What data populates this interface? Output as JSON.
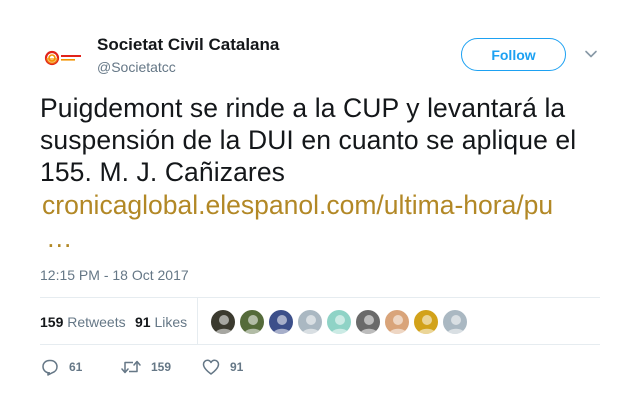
{
  "author": {
    "display_name": "Societat Civil Catalana",
    "handle": "@Societatcc"
  },
  "follow_label": "Follow",
  "tweet": {
    "text": "Puigdemont se rinde a la CUP y levantará la suspensión de la DUI en cuanto se aplique el 155. M. J. Cañizares",
    "link": "cronicaglobal.elespanol.com/ultima-hora/pu",
    "ellipsis": "…",
    "timestamp": "12:15 PM - 18 Oct 2017"
  },
  "stats": {
    "retweets_count": "159",
    "retweets_label": "Retweets",
    "likes_count": "91",
    "likes_label": "Likes"
  },
  "likers": [
    {
      "name": "liker-1",
      "color": "#3b3a2f"
    },
    {
      "name": "liker-2",
      "color": "#556b3a"
    },
    {
      "name": "liker-3",
      "color": "#3c4f8a"
    },
    {
      "name": "liker-4",
      "color": "#aab8c2"
    },
    {
      "name": "liker-5",
      "color": "#8fd3c6"
    },
    {
      "name": "liker-6",
      "color": "#6a6a6a"
    },
    {
      "name": "liker-7",
      "color": "#d9a47a"
    },
    {
      "name": "liker-8",
      "color": "#d2a21a"
    },
    {
      "name": "liker-9",
      "color": "#aab8c2"
    }
  ],
  "actions": {
    "reply_count": "61",
    "retweet_count": "159",
    "like_count": "91"
  },
  "colors": {
    "brand_blue": "#1da1f2",
    "link_color": "#b28826",
    "muted": "#657786"
  }
}
